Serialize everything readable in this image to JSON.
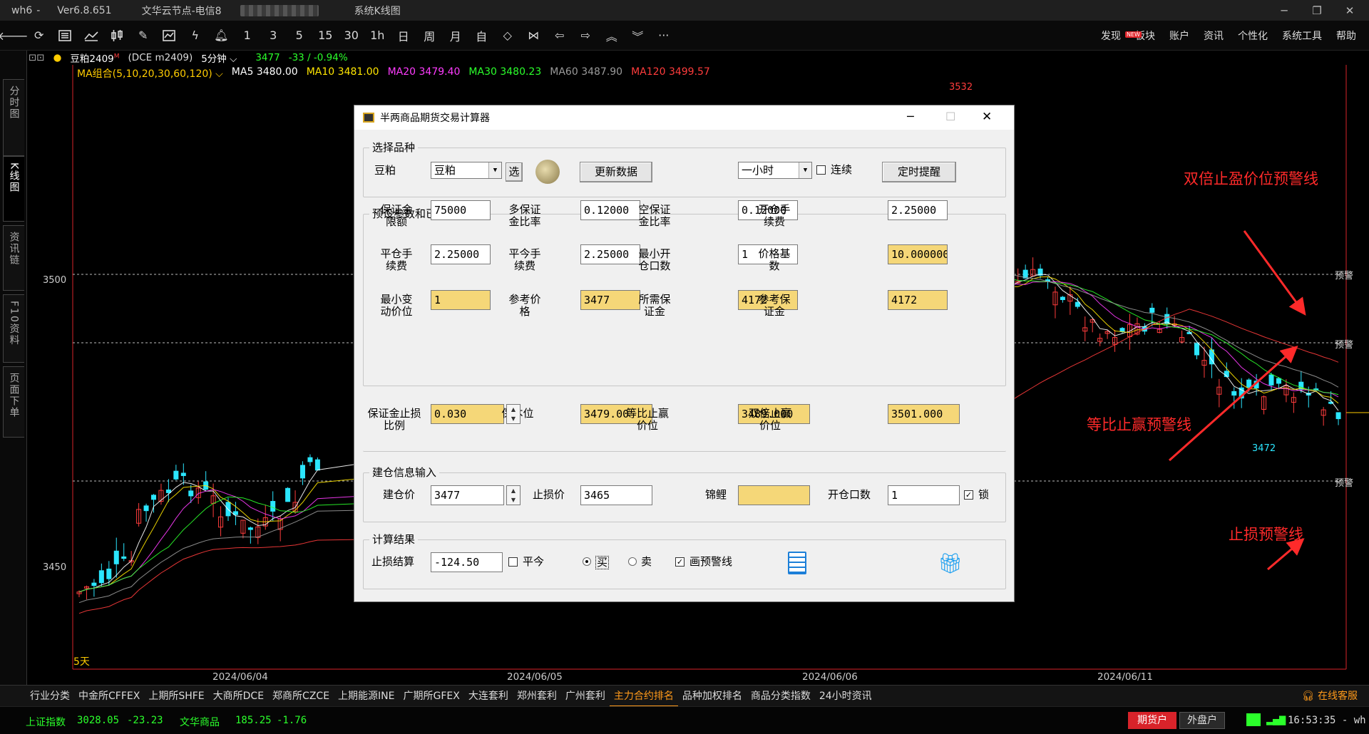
{
  "titlebar": {
    "app": "wh6",
    "version": "Ver6.8.651",
    "server": "文华云节点-电信8",
    "window_title": "系统K线图"
  },
  "toolbar": {
    "periods": [
      "1",
      "3",
      "5",
      "15",
      "30",
      "1h",
      "日",
      "周",
      "月",
      "自"
    ]
  },
  "menu": {
    "items": [
      "发现",
      "板块",
      "账户",
      "资讯",
      "个性化",
      "系统工具",
      "帮助"
    ],
    "new_badge": "NEW"
  },
  "sidebar": {
    "tabs": [
      "分时图",
      "K线图",
      "资讯链",
      "F10资料",
      "页面下单"
    ]
  },
  "chart": {
    "symbol": "豆粕2409",
    "symbol_mark": "M",
    "code": "(DCE m2409)",
    "period": "5分钟",
    "price": "3477",
    "change": "-33 / -0.94%",
    "ma_label": "MA组合(5,10,20,30,60,120)",
    "ma": [
      {
        "label": "MA5",
        "value": "3480.00",
        "color": "#ffffff"
      },
      {
        "label": "MA10",
        "value": "3481.00",
        "color": "#ffe600"
      },
      {
        "label": "MA20",
        "value": "3479.40",
        "color": "#ff3cff"
      },
      {
        "label": "MA30",
        "value": "3480.23",
        "color": "#2bff2b"
      },
      {
        "label": "MA60",
        "value": "3487.90",
        "color": "#9a9a9a"
      },
      {
        "label": "MA120",
        "value": "3499.57",
        "color": "#ff3c3c"
      }
    ],
    "high_label": "3532",
    "low_label": "3472",
    "y_labels": [
      "3500",
      "3450"
    ],
    "x_labels": [
      "2024/06/04",
      "2024/06/05",
      "2024/06/06",
      "2024/06/11"
    ],
    "days_label": "5天",
    "warn_label": "预警",
    "annotations": {
      "double_tp": "双倍止盈价位预警线",
      "equal_tp": "等比止赢预警线",
      "stop_loss": "止损预警线"
    }
  },
  "dialog": {
    "title": "半两商品期货交易计算器",
    "select_group": "选择品种",
    "select_label": "豆粕",
    "symbol_value": "豆粕",
    "pick_btn": "选",
    "update_btn": "更新数据",
    "period_value": "一小时",
    "continuous_label": "连续",
    "timer_btn": "定时提醒",
    "params_group": "预设参数和已知参数",
    "params": [
      {
        "label": "保证金限额",
        "value": "75000",
        "hl": false
      },
      {
        "label": "多保证金比率",
        "value": "0.12000",
        "hl": false
      },
      {
        "label": "空保证金比率",
        "value": "0.12000",
        "hl": false
      },
      {
        "label": "开仓手续费",
        "value": "2.25000",
        "hl": false
      },
      {
        "label": "平仓手续费",
        "value": "2.25000",
        "hl": false
      },
      {
        "label": "平今手续费",
        "value": "2.25000",
        "hl": false
      },
      {
        "label": "最小开仓口数",
        "value": "1",
        "hl": false
      },
      {
        "label": "价格基数",
        "value": "10.000000",
        "hl": true
      },
      {
        "label": "最小变动价位",
        "value": "1",
        "hl": true
      },
      {
        "label": "参考价格",
        "value": "3477",
        "hl": true
      },
      {
        "label": "所需保证金",
        "value": "4172",
        "hl": true
      },
      {
        "label": "参考保证金",
        "value": "4172",
        "hl": true
      }
    ],
    "ratio": [
      {
        "label": "保证金止损比例",
        "value": "0.030",
        "hl": true
      },
      {
        "label": "保本位",
        "value": "3479.00",
        "hl": true
      },
      {
        "label": "等比止赢价位",
        "value": "3489.000",
        "hl": true
      },
      {
        "label": "双倍止赢价位",
        "value": "3501.000",
        "hl": true
      }
    ],
    "open_group": "建仓信息输入",
    "open_price_label": "建仓价",
    "open_price": "3477",
    "stop_label": "止损价",
    "stop_price": "3465",
    "koi_label": "锦鲤",
    "koi_value": "",
    "lots_label": "开仓口数",
    "lots": "1",
    "lock_label": "锁",
    "result_group": "计算结果",
    "pnl_label": "止损结算",
    "pnl": "-124.50",
    "close_today": "平今",
    "buy": "买",
    "sell": "卖",
    "draw_lines": "画预警线"
  },
  "bottom": {
    "tabs": [
      "行业分类",
      "中金所CFFEX",
      "上期所SHFE",
      "大商所DCE",
      "郑商所CZCE",
      "上期能源INE",
      "广期所GFEX",
      "大连套利",
      "郑州套利",
      "广州套利",
      "主力合约排名",
      "品种加权排名",
      "商品分类指数",
      "24小时资讯"
    ],
    "active": 10,
    "service": "在线客服"
  },
  "status": {
    "idx1_name": "上证指数",
    "idx1_val": "3028.05",
    "idx1_chg": "-23.23",
    "idx2_name": "文华商品",
    "idx2_val": "185.25",
    "idx2_chg": "-1.76",
    "futures_btn": "期货户",
    "foreign_btn": "外盘户",
    "time": "16:53:35 - wh"
  }
}
